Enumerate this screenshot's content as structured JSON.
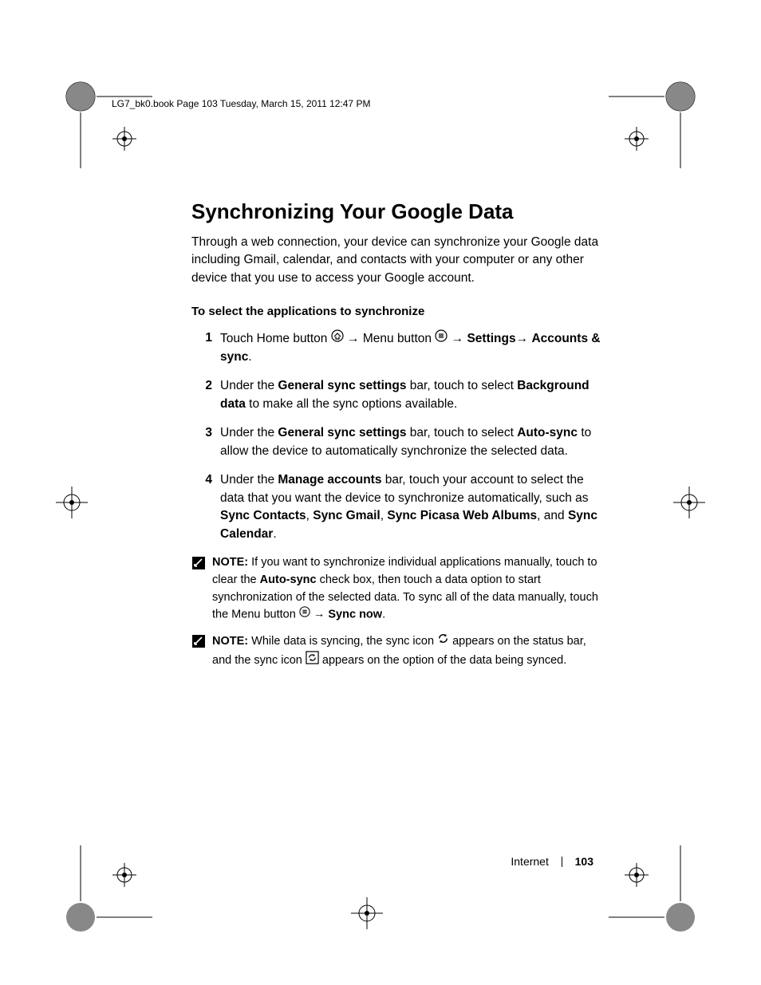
{
  "headerline": "LG7_bk0.book  Page 103  Tuesday, March 15, 2011  12:47 PM",
  "title": "Synchronizing Your Google Data",
  "intro": "Through a web connection, your device can synchronize your Google data including Gmail, calendar, and contacts with your computer or any other device that you use to access your Google account.",
  "subhead": "To select the applications to synchronize",
  "step1": {
    "num": "1",
    "a": "Touch Home button ",
    "b": " Menu button ",
    "c": " ",
    "settings": "Settings",
    "d": " ",
    "accounts": "Accounts & sync",
    "e": "."
  },
  "step2": {
    "num": "2",
    "a": "Under the ",
    "b1": "General sync settings",
    "b": " bar, touch to select ",
    "b2": "Background data",
    "c": " to make all the sync options available."
  },
  "step3": {
    "num": "3",
    "a": "Under the ",
    "b1": "General sync settings",
    "b": " bar, touch to select ",
    "b2": "Auto-sync",
    "c": " to allow the device to automatically synchronize the selected data."
  },
  "step4": {
    "num": "4",
    "a": "Under the ",
    "b1": "Manage accounts",
    "b": " bar, touch your account to select the data that you want the device to synchronize automatically, such as ",
    "s1": "Sync Contacts",
    "c": ", ",
    "s2": "Sync Gmail",
    "d": ", ",
    "s3": "Sync Picasa Web Albums",
    "e": ", and ",
    "s4": "Sync Calendar",
    "f": "."
  },
  "note1": {
    "label": "NOTE:",
    "a": " If you want to synchronize individual applications manually, touch to clear the ",
    "b1": "Auto-sync",
    "b": " check box, then touch a data option to start synchronization of the selected data. To sync all of the data manually, touch the Menu button ",
    "c": " ",
    "b2": "Sync now",
    "d": "."
  },
  "note2": {
    "label": "NOTE:",
    "a": " While data is syncing, the sync icon ",
    "b": " appears on the status bar, and the sync icon ",
    "c": " appears on the option of the data being synced."
  },
  "footer": {
    "section": "Internet",
    "page": "103"
  }
}
